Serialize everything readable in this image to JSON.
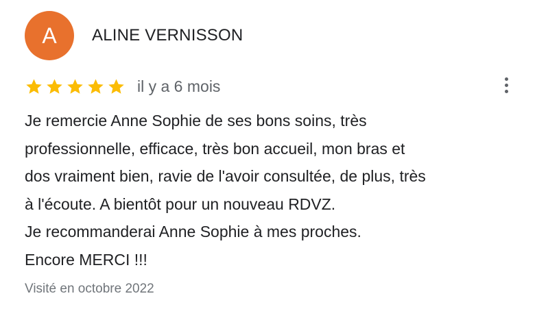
{
  "review": {
    "avatar_letter": "A",
    "avatar_color": "#e8712d",
    "author": "ALINE VERNISSON",
    "rating": 5,
    "rating_max": 5,
    "star_color": "#fbbc04",
    "time": "il y a 6 mois",
    "more_icon": "more-vertical-icon",
    "text_lines": [
      "Je remercie Anne Sophie de ses bons soins, très",
      "professionnelle, efficace, très bon accueil, mon bras et",
      "dos vraiment bien, ravie de l'avoir consultée, de plus, très",
      "à l'écoute. A bientôt pour un nouveau RDVZ.",
      "Je recommanderai Anne Sophie à mes proches.",
      "Encore MERCI !!!"
    ],
    "visited": "Visité en octobre 2022"
  }
}
